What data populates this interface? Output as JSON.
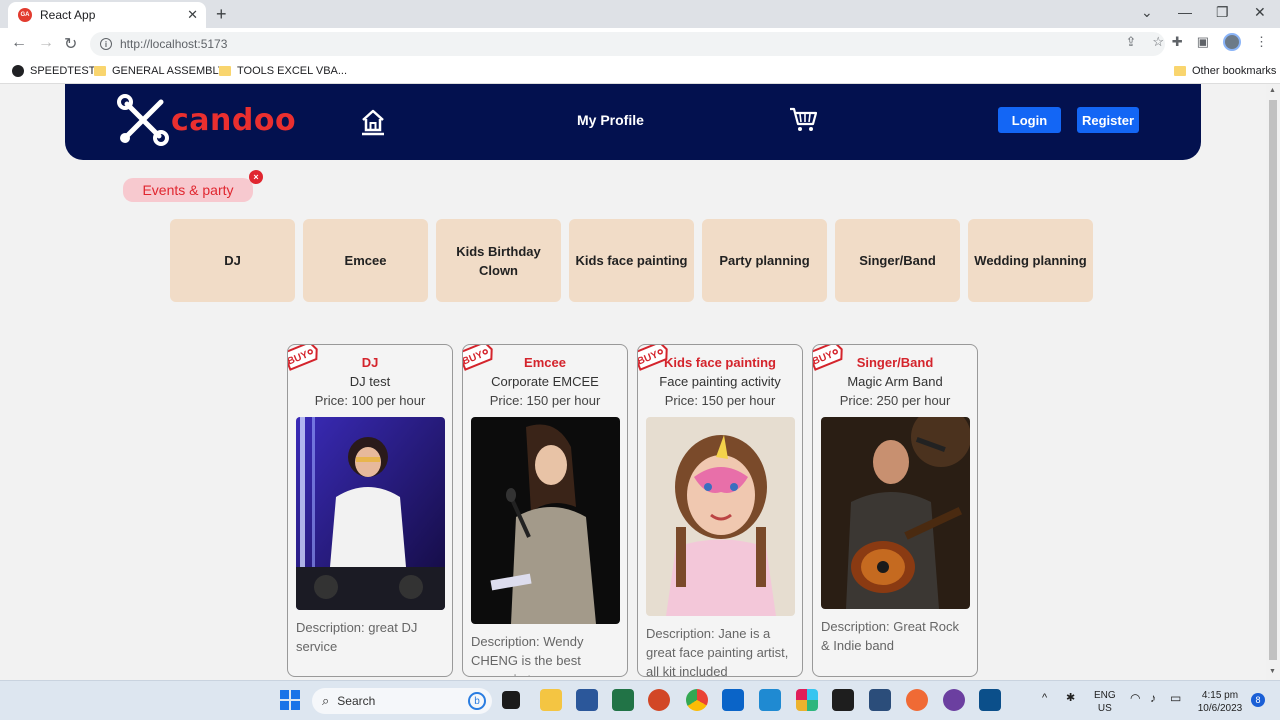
{
  "browser": {
    "tab_title": "React App",
    "tab_favicon": "GA",
    "url": "http://localhost:5173",
    "bookmarks": [
      {
        "label": "SPEEDTEST"
      },
      {
        "label": "GENERAL ASSEMBLY"
      },
      {
        "label": "TOOLS EXCEL VBA..."
      }
    ],
    "other_bookmarks": "Other bookmarks"
  },
  "navbar": {
    "logo_text": "candoo",
    "profile_label": "My Profile",
    "login_label": "Login",
    "register_label": "Register"
  },
  "filter_chip": {
    "label": "Events & party",
    "close_glyph": "×"
  },
  "categories": [
    {
      "label": "DJ"
    },
    {
      "label": "Emcee"
    },
    {
      "label": "Kids Birthday Clown"
    },
    {
      "label": "Kids face painting"
    },
    {
      "label": "Party planning"
    },
    {
      "label": "Singer/Band"
    },
    {
      "label": "Wedding planning"
    }
  ],
  "listings": [
    {
      "category": "DJ",
      "title": "DJ test",
      "price": "Price: 100 per hour",
      "description": "Description: great DJ service",
      "img_height": 193
    },
    {
      "category": "Emcee",
      "title": "Corporate EMCEE",
      "price": "Price: 150 per hour",
      "description": "Description: Wendy CHENG is the best emcee in town",
      "img_height": 207
    },
    {
      "category": "Kids face painting",
      "title": "Face painting activity",
      "price": "Price: 150 per hour",
      "description": "Description: Jane is a great face painting artist, all kit included",
      "img_height": 199
    },
    {
      "category": "Singer/Band",
      "title": "Magic Arm Band",
      "price": "Price: 250 per hour",
      "description": "Description: Great Rock & Indie band",
      "img_height": 192
    }
  ],
  "buy_tag": "BUY",
  "taskbar": {
    "search_label": "Search",
    "lang_line1": "ENG",
    "lang_line2": "US",
    "time": "4:15 pm",
    "date": "10/6/2023",
    "notification_count": "8"
  },
  "colors": {
    "navbar": "#03114f",
    "brand_red": "#ea2f2f",
    "button_blue": "#1366f5",
    "category_tile": "#f1dcc7",
    "chip_bg": "#f7c9cf"
  }
}
